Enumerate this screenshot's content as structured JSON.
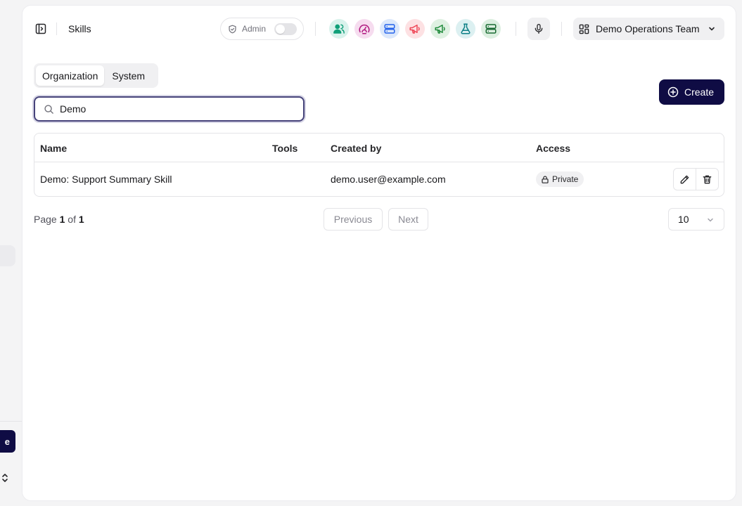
{
  "header": {
    "title": "Skills",
    "admin_label": "Admin",
    "admin_enabled": false,
    "team_label": "Demo Operations Team",
    "app_icons": [
      {
        "name": "users-icon",
        "bg": "#d9f2ec",
        "color": "#0f9f78"
      },
      {
        "name": "gauge-icon",
        "bg": "#f6dcef",
        "color": "#b0187f"
      },
      {
        "name": "server-icon",
        "bg": "#dce8fb",
        "color": "#2563eb"
      },
      {
        "name": "megaphone-red-icon",
        "bg": "#fde1e3",
        "color": "#ef4455"
      },
      {
        "name": "megaphone-green-icon",
        "bg": "#dff1e2",
        "color": "#1f8a3a"
      },
      {
        "name": "flask-icon",
        "bg": "#dcf0f1",
        "color": "#0e7f86"
      },
      {
        "name": "server-dark-icon",
        "bg": "#dcefe0",
        "color": "#1a6b33"
      }
    ]
  },
  "tabs": [
    {
      "label": "Organization",
      "active": true
    },
    {
      "label": "System",
      "active": false
    }
  ],
  "create_label": "Create",
  "search": {
    "value": "Demo"
  },
  "table": {
    "columns": {
      "name": "Name",
      "tools": "Tools",
      "created_by": "Created by",
      "access": "Access"
    },
    "rows": [
      {
        "name": "Demo: Support Summary Skill",
        "tools": "",
        "created_by": "demo.user@example.com",
        "access": "Private"
      }
    ]
  },
  "pagination": {
    "page_word": "Page",
    "current": "1",
    "of_word": "of",
    "total": "1",
    "previous_label": "Previous",
    "next_label": "Next",
    "page_size": "10"
  },
  "colors": {
    "accent": "#0f0c44",
    "search_border": "#46437a"
  }
}
